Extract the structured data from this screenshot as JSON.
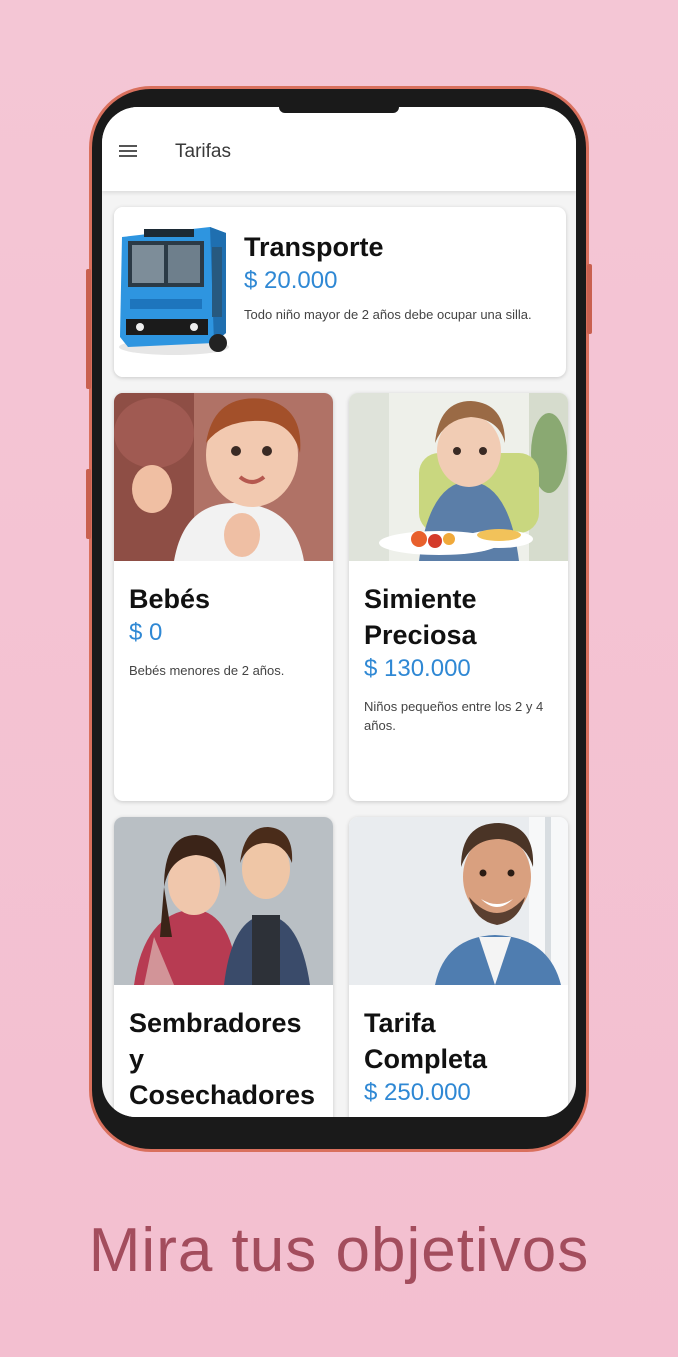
{
  "appbar": {
    "title": "Tarifas"
  },
  "featured": {
    "title": "Transporte",
    "price": "$ 20.000",
    "description": "Todo niño mayor de 2 años debe ocupar una silla."
  },
  "cards": [
    {
      "title": "Bebés",
      "price": "$ 0",
      "description": "Bebés menores de 2 años."
    },
    {
      "title": "Simiente Preciosa",
      "price": "$ 130.000",
      "description": "Niños pequeños entre los 2 y 4 años."
    },
    {
      "title": "Sembradores y Cosechadores",
      "price": "",
      "description": ""
    },
    {
      "title": "Tarifa Completa",
      "price": "$ 250.000",
      "description": ""
    }
  ],
  "tagline": "Mira tus objetivos",
  "colors": {
    "background": "#f4c6d5",
    "accent_price": "#2f88d4",
    "tagline": "#a34d5d",
    "phone_frame": "#d9705d"
  }
}
